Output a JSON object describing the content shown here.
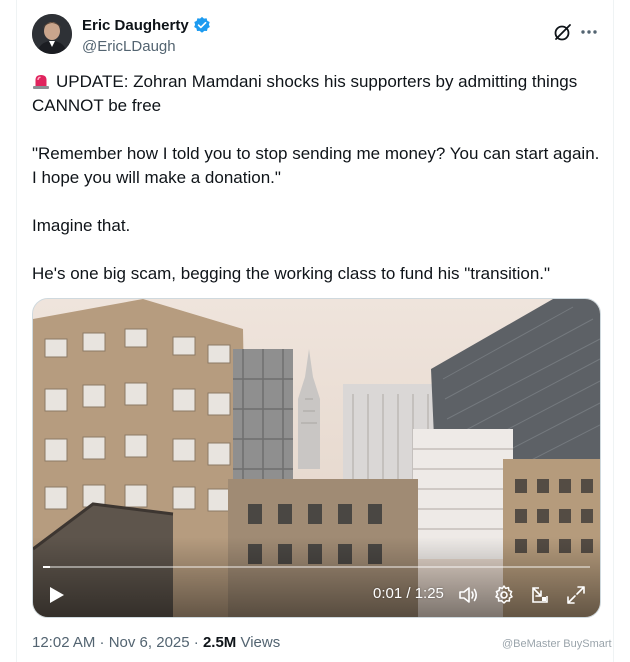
{
  "author": {
    "name": "Eric Daugherty",
    "handle": "@EricLDaugh",
    "verified": true
  },
  "tweet": {
    "paragraphs": [
      "UPDATE: Zohran Mamdani shocks his supporters by admitting things CANNOT be free",
      "\"Remember how I told you to stop sending me money? You can start again. I hope you will make a donation.\"",
      "Imagine that.",
      "He's one big scam, begging the working class to fund his \"transition.\""
    ],
    "lead_icon": "siren-icon"
  },
  "video": {
    "time": "0:01 / 1:25",
    "progress_fraction": 0.012,
    "controls": [
      "play-icon",
      "volume-icon",
      "settings-gear-icon",
      "picture-in-picture-icon",
      "fullscreen-icon"
    ]
  },
  "meta": {
    "timestamp": "12:02 AM · Nov 6, 2025 · ",
    "views_count": "2.5M",
    "views_label": " Views"
  },
  "watermark": "@BeMaster BuySmart",
  "colors": {
    "text": "#0f1419",
    "secondary": "#536471",
    "verified": "#1d9bf0",
    "siren": "#e0245e"
  }
}
